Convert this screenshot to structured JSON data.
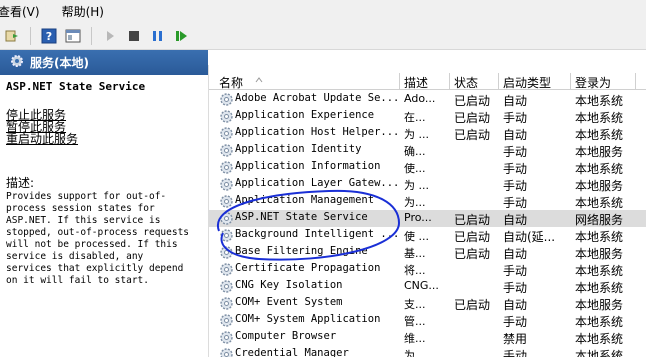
{
  "menu": [
    "查看(V)",
    "帮助(H)"
  ],
  "toolbar": {
    "icons": [
      "forward-icon",
      "help-icon",
      "properties-icon",
      "play-icon",
      "stop-icon",
      "pause-icon",
      "restart-icon"
    ]
  },
  "left": {
    "header": "服务(本地)",
    "service_title": "ASP.NET State Service",
    "links": [
      "停止此服务",
      "暂停此服务",
      "重启动此服务"
    ],
    "desc_label": "描述:",
    "description": [
      "Provides support for out-of-",
      "process session states for",
      "ASP.NET. If this service is",
      "stopped, out-of-process requests",
      "will not be processed. If this",
      "service is disabled, any",
      "services that explicitly depend",
      "on it will fail to start."
    ]
  },
  "table": {
    "headers": [
      "名称",
      "描述",
      "状态",
      "启动类型",
      "登录为"
    ],
    "rows": [
      {
        "name": "Adobe Acrobat Update Se...",
        "desc": "Ado...",
        "status": "已启动",
        "type": "自动",
        "logon": "本地系统"
      },
      {
        "name": "Application Experience",
        "desc": "在...",
        "status": "已启动",
        "type": "手动",
        "logon": "本地系统"
      },
      {
        "name": "Application Host Helper...",
        "desc": "为 ...",
        "status": "已启动",
        "type": "自动",
        "logon": "本地系统"
      },
      {
        "name": "Application Identity",
        "desc": "确...",
        "status": "",
        "type": "手动",
        "logon": "本地服务"
      },
      {
        "name": "Application Information",
        "desc": "使...",
        "status": "",
        "type": "手动",
        "logon": "本地系统"
      },
      {
        "name": "Application Layer Gatew...",
        "desc": "为 ...",
        "status": "",
        "type": "手动",
        "logon": "本地服务"
      },
      {
        "name": "Application Management",
        "desc": "为...",
        "status": "",
        "type": "手动",
        "logon": "本地系统"
      },
      {
        "name": "ASP.NET State Service",
        "desc": "Pro...",
        "status": "已启动",
        "type": "自动",
        "logon": "网络服务"
      },
      {
        "name": "Background Intelligent ...",
        "desc": "使 ...",
        "status": "已启动",
        "type": "自动(延...",
        "logon": "本地系统"
      },
      {
        "name": "Base Filtering Engine",
        "desc": "基...",
        "status": "已启动",
        "type": "自动",
        "logon": "本地服务"
      },
      {
        "name": "Certificate Propagation",
        "desc": "将...",
        "status": "",
        "type": "手动",
        "logon": "本地系统"
      },
      {
        "name": "CNG Key Isolation",
        "desc": "CNG...",
        "status": "",
        "type": "手动",
        "logon": "本地系统"
      },
      {
        "name": "COM+ Event System",
        "desc": "支...",
        "status": "已启动",
        "type": "自动",
        "logon": "本地服务"
      },
      {
        "name": "COM+ System Application",
        "desc": "管...",
        "status": "",
        "type": "手动",
        "logon": "本地系统"
      },
      {
        "name": "Computer Browser",
        "desc": "维...",
        "status": "",
        "type": "禁用",
        "logon": "本地系统"
      },
      {
        "name": "Credential Manager",
        "desc": "为 ...",
        "status": "",
        "type": "手动",
        "logon": "本地系统"
      }
    ],
    "selected_index": 7
  },
  "colors": {
    "header_blue": "#2f62a6",
    "annotation": "#1a2fd6",
    "selected_row": "#dcdcdc"
  }
}
